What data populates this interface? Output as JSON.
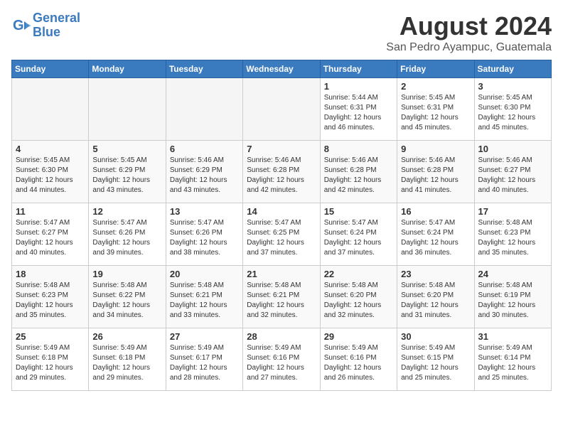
{
  "header": {
    "logo_line1": "General",
    "logo_line2": "Blue",
    "month_title": "August 2024",
    "location": "San Pedro Ayampuc, Guatemala"
  },
  "days_of_week": [
    "Sunday",
    "Monday",
    "Tuesday",
    "Wednesday",
    "Thursday",
    "Friday",
    "Saturday"
  ],
  "weeks": [
    [
      {
        "day": "",
        "empty": true
      },
      {
        "day": "",
        "empty": true
      },
      {
        "day": "",
        "empty": true
      },
      {
        "day": "",
        "empty": true
      },
      {
        "day": "1",
        "sunrise": "5:44 AM",
        "sunset": "6:31 PM",
        "daylight": "12 hours and 46 minutes."
      },
      {
        "day": "2",
        "sunrise": "5:45 AM",
        "sunset": "6:31 PM",
        "daylight": "12 hours and 45 minutes."
      },
      {
        "day": "3",
        "sunrise": "5:45 AM",
        "sunset": "6:30 PM",
        "daylight": "12 hours and 45 minutes."
      }
    ],
    [
      {
        "day": "4",
        "sunrise": "5:45 AM",
        "sunset": "6:30 PM",
        "daylight": "12 hours and 44 minutes."
      },
      {
        "day": "5",
        "sunrise": "5:45 AM",
        "sunset": "6:29 PM",
        "daylight": "12 hours and 43 minutes."
      },
      {
        "day": "6",
        "sunrise": "5:46 AM",
        "sunset": "6:29 PM",
        "daylight": "12 hours and 43 minutes."
      },
      {
        "day": "7",
        "sunrise": "5:46 AM",
        "sunset": "6:28 PM",
        "daylight": "12 hours and 42 minutes."
      },
      {
        "day": "8",
        "sunrise": "5:46 AM",
        "sunset": "6:28 PM",
        "daylight": "12 hours and 42 minutes."
      },
      {
        "day": "9",
        "sunrise": "5:46 AM",
        "sunset": "6:28 PM",
        "daylight": "12 hours and 41 minutes."
      },
      {
        "day": "10",
        "sunrise": "5:46 AM",
        "sunset": "6:27 PM",
        "daylight": "12 hours and 40 minutes."
      }
    ],
    [
      {
        "day": "11",
        "sunrise": "5:47 AM",
        "sunset": "6:27 PM",
        "daylight": "12 hours and 40 minutes."
      },
      {
        "day": "12",
        "sunrise": "5:47 AM",
        "sunset": "6:26 PM",
        "daylight": "12 hours and 39 minutes."
      },
      {
        "day": "13",
        "sunrise": "5:47 AM",
        "sunset": "6:26 PM",
        "daylight": "12 hours and 38 minutes."
      },
      {
        "day": "14",
        "sunrise": "5:47 AM",
        "sunset": "6:25 PM",
        "daylight": "12 hours and 37 minutes."
      },
      {
        "day": "15",
        "sunrise": "5:47 AM",
        "sunset": "6:24 PM",
        "daylight": "12 hours and 37 minutes."
      },
      {
        "day": "16",
        "sunrise": "5:47 AM",
        "sunset": "6:24 PM",
        "daylight": "12 hours and 36 minutes."
      },
      {
        "day": "17",
        "sunrise": "5:48 AM",
        "sunset": "6:23 PM",
        "daylight": "12 hours and 35 minutes."
      }
    ],
    [
      {
        "day": "18",
        "sunrise": "5:48 AM",
        "sunset": "6:23 PM",
        "daylight": "12 hours and 35 minutes."
      },
      {
        "day": "19",
        "sunrise": "5:48 AM",
        "sunset": "6:22 PM",
        "daylight": "12 hours and 34 minutes."
      },
      {
        "day": "20",
        "sunrise": "5:48 AM",
        "sunset": "6:21 PM",
        "daylight": "12 hours and 33 minutes."
      },
      {
        "day": "21",
        "sunrise": "5:48 AM",
        "sunset": "6:21 PM",
        "daylight": "12 hours and 32 minutes."
      },
      {
        "day": "22",
        "sunrise": "5:48 AM",
        "sunset": "6:20 PM",
        "daylight": "12 hours and 32 minutes."
      },
      {
        "day": "23",
        "sunrise": "5:48 AM",
        "sunset": "6:20 PM",
        "daylight": "12 hours and 31 minutes."
      },
      {
        "day": "24",
        "sunrise": "5:48 AM",
        "sunset": "6:19 PM",
        "daylight": "12 hours and 30 minutes."
      }
    ],
    [
      {
        "day": "25",
        "sunrise": "5:49 AM",
        "sunset": "6:18 PM",
        "daylight": "12 hours and 29 minutes."
      },
      {
        "day": "26",
        "sunrise": "5:49 AM",
        "sunset": "6:18 PM",
        "daylight": "12 hours and 29 minutes."
      },
      {
        "day": "27",
        "sunrise": "5:49 AM",
        "sunset": "6:17 PM",
        "daylight": "12 hours and 28 minutes."
      },
      {
        "day": "28",
        "sunrise": "5:49 AM",
        "sunset": "6:16 PM",
        "daylight": "12 hours and 27 minutes."
      },
      {
        "day": "29",
        "sunrise": "5:49 AM",
        "sunset": "6:16 PM",
        "daylight": "12 hours and 26 minutes."
      },
      {
        "day": "30",
        "sunrise": "5:49 AM",
        "sunset": "6:15 PM",
        "daylight": "12 hours and 25 minutes."
      },
      {
        "day": "31",
        "sunrise": "5:49 AM",
        "sunset": "6:14 PM",
        "daylight": "12 hours and 25 minutes."
      }
    ]
  ]
}
